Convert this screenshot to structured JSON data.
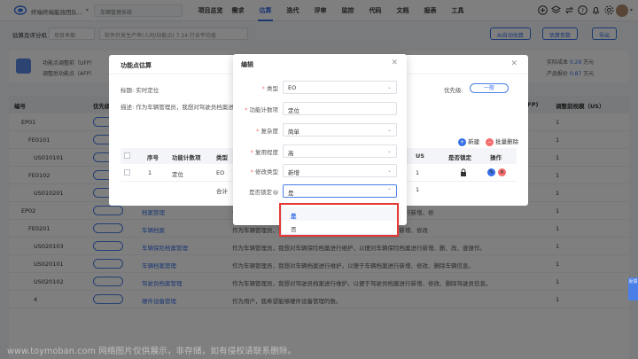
{
  "topbar": {
    "team_name": "终端终端能效团队...",
    "project_name": "车辆管理系统",
    "nav": [
      "项目总览",
      "需求",
      "估算",
      "迭代",
      "评审",
      "监控",
      "代码",
      "文档",
      "报表",
      "工具"
    ],
    "active_nav": "估算"
  },
  "subbar": {
    "label": "估算及评分机",
    "select1": "项目早期",
    "select2": "软件开发生产率(人时/功能点) 7.14 行业平均值",
    "btn_ai": "AI自动估算",
    "btn_save": "估算参数",
    "btn_export": "导出"
  },
  "summary": {
    "line1": "功能点调整前（UFP）",
    "line2": "调整后功能点（AFP）",
    "right1_label": "实际成本",
    "right1_value": "0.29",
    "right1_unit": "万元",
    "right2_label": "产品报价",
    "right2_value": "0.87",
    "right2_unit": "万元"
  },
  "bg_table": {
    "headers": [
      "编号",
      "优先级",
      "UFP)",
      "调整前规模（US）"
    ],
    "rows": [
      {
        "code": "EP01",
        "link": "",
        "desc": "",
        "num": "1"
      },
      {
        "code": "FE0101",
        "link": "",
        "desc": "",
        "num": "1"
      },
      {
        "code": "US010101",
        "link": "",
        "desc": "",
        "num": "1"
      },
      {
        "code": "FE0102",
        "link": "",
        "desc": "",
        "num": "1"
      },
      {
        "code": "US010201",
        "link": "",
        "desc": "",
        "num": "1"
      },
      {
        "code": "EP02",
        "link": "档案管理",
        "desc": "作为车辆管理员，我想对车辆档案管理进行维护，以便对车辆档案进行新增、修",
        "num": "1"
      },
      {
        "code": "FE0201",
        "link": "车辆档案",
        "desc": "作为车辆管理员，我想对车辆档案进行维护，以便对车辆档案进行新增、修改",
        "num": "1"
      },
      {
        "code": "US020103",
        "link": "车辆保险档案管理",
        "desc": "作为车辆管理员，我想对车辆保险档案进行维护，以便对车辆保险档案进行新增、删、改、查操作。",
        "num": "1"
      },
      {
        "code": "US020101",
        "link": "车辆档案管理",
        "desc": "作为车辆管理员，我想对车辆档案进行维护，以便于车辆档案进行新增、修改、删除车辆信息。",
        "num": "1"
      },
      {
        "code": "US020102",
        "link": "驾驶员档案管理",
        "desc": "作为车辆管理员，我想对驾驶员档案进行维护，以便于驾驶员档案进行新增、修改、删除驾驶员信息。",
        "num": "1"
      },
      {
        "code": "4",
        "link": "硬件设备管理",
        "desc": "作为用户，我希望能够硬件设备管理的数。",
        "num": "1"
      }
    ]
  },
  "fp_dialog": {
    "title": "功能点估算",
    "title_label": "标题:",
    "title_value": "实时定位",
    "priority_label": "优先级:",
    "priority_value": "一般",
    "desc_label": "描述:",
    "desc_value": "作为车辆管理员，我想对驾驶员档案进行维护，以便于驾驶员档案进行新增",
    "add_label": "新建",
    "batch_delete_label": "批量删除",
    "headers": [
      "序号",
      "功能计数项",
      "类型",
      "US",
      "是否锁定",
      "操作"
    ],
    "row": {
      "index": "1",
      "item": "定位",
      "type": "EO",
      "us": "1"
    },
    "total_label": "合计",
    "total_us": "1"
  },
  "edit_dialog": {
    "title": "编辑",
    "fields": [
      {
        "label": "类型",
        "value": "EO",
        "required": true,
        "type": "select"
      },
      {
        "label": "功能计数项",
        "value": "定位",
        "required": true,
        "type": "input"
      },
      {
        "label": "复杂度",
        "value": "简单",
        "required": true,
        "type": "select"
      },
      {
        "label": "复用程度",
        "value": "高",
        "required": true,
        "type": "select"
      },
      {
        "label": "修改类型",
        "value": "新增",
        "required": true,
        "type": "select"
      }
    ],
    "lock_label": "是否锁定",
    "lock_value": "是",
    "options": [
      "是",
      "否"
    ]
  },
  "side_tab": "反馈",
  "watermark": "www.toymoban.com 网络图片仅供展示，非存储，如有侵权请联系删除。",
  "colors": {
    "accent": "#3770e6",
    "overlay": "rgba(0,0,0,0.5)",
    "highlight": "#e53935"
  }
}
